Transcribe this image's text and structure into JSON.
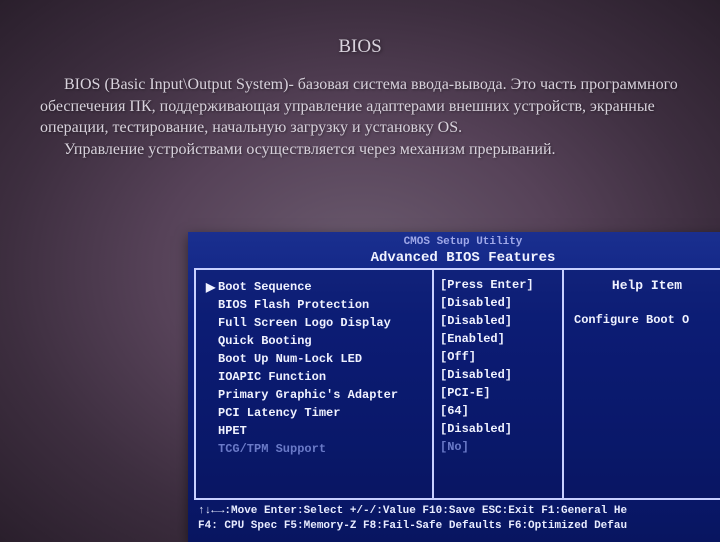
{
  "title": "BIOS",
  "paragraphs": [
    "BIOS (Basic Input\\Output System)- базовая система ввода-вывода. Это часть программного обеспечения ПК, поддерживающая управление адаптерами внешних устройств, экранные операции, тестирование, начальную загрузку и установку OS.",
    "Управление устройствами осуществляется через механизм прерываний."
  ],
  "bios": {
    "header_top": "CMOS Setup Utility",
    "header_main": "Advanced BIOS Features",
    "items": [
      {
        "label": "Boot Sequence",
        "value": "[Press Enter]",
        "selected": true
      },
      {
        "label": "BIOS Flash Protection",
        "value": "[Disabled]"
      },
      {
        "label": "Full Screen Logo Display",
        "value": "[Disabled]"
      },
      {
        "label": "Quick Booting",
        "value": "[Enabled]"
      },
      {
        "label": "Boot Up Num-Lock LED",
        "value": "[Off]"
      },
      {
        "label": "IOAPIC Function",
        "value": "[Disabled]"
      },
      {
        "label": "Primary Graphic's Adapter",
        "value": "[PCI-E]"
      },
      {
        "label": "PCI Latency Timer",
        "value": "[64]"
      },
      {
        "label": "HPET",
        "value": "[Disabled]"
      },
      {
        "label": "TCG/TPM Support",
        "value": "[No]",
        "dim": true
      }
    ],
    "help_title": "Help Item",
    "help_text": "Configure Boot O",
    "footer1": "↑↓←→:Move  Enter:Select  +/-/:Value  F10:Save  ESC:Exit  F1:General He",
    "footer2": "F4: CPU Spec  F5:Memory-Z     F8:Fail-Safe Defaults   F6:Optimized Defau"
  }
}
